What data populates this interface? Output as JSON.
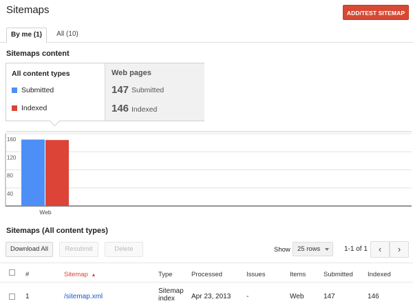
{
  "header": {
    "title": "Sitemaps",
    "add_button": "ADD/TEST SITEMAP"
  },
  "tabs": [
    {
      "label": "By me (1)",
      "active": true
    },
    {
      "label": "All (10)",
      "active": false
    }
  ],
  "content_section": {
    "title": "Sitemaps content",
    "content_types_label": "All content types",
    "legend": [
      {
        "label": "Submitted",
        "color": "#4d8ff6"
      },
      {
        "label": "Indexed",
        "color": "#db4437"
      }
    ],
    "web_pages": {
      "title": "Web pages",
      "submitted_value": "147",
      "submitted_label": "Submitted",
      "indexed_value": "146",
      "indexed_label": "Indexed"
    }
  },
  "chart_data": {
    "type": "bar",
    "categories": [
      "Web"
    ],
    "series": [
      {
        "name": "Submitted",
        "values": [
          147
        ],
        "color": "#4d8ff6"
      },
      {
        "name": "Indexed",
        "values": [
          146
        ],
        "color": "#db4437"
      }
    ],
    "yticks": [
      40,
      80,
      120,
      160
    ],
    "ylim": [
      0,
      160
    ],
    "grid": true
  },
  "table_section": {
    "title": "Sitemaps (All content types)",
    "download_button": "Download All",
    "resubmit_button": "Resubmit",
    "delete_button": "Delete",
    "show_label": "Show",
    "rows_select": "25 rows",
    "pagination_text": "1-1 of 1",
    "prev_icon": "‹",
    "next_icon": "›",
    "columns": {
      "num": "#",
      "sitemap": "Sitemap",
      "sort_icon": "▲",
      "type": "Type",
      "processed": "Processed",
      "issues": "Issues",
      "items": "Items",
      "submitted": "Submitted",
      "indexed": "Indexed"
    },
    "rows": [
      {
        "num": "1",
        "sitemap": "/sitemap.xml",
        "type_line1": "Sitemap",
        "type_line2": "index",
        "processed": "Apr 23, 2013",
        "issues": "-",
        "items": "Web",
        "submitted": "147",
        "indexed": "146"
      }
    ]
  },
  "colors": {
    "accent_red": "#d64933",
    "link_blue": "#1a56c8",
    "sort_red": "#d14836"
  }
}
